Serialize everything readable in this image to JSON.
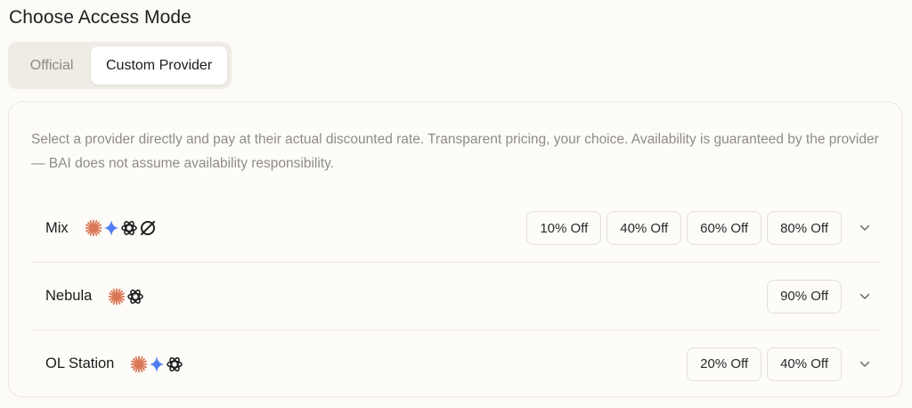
{
  "page": {
    "title": "Choose Access Mode"
  },
  "tabs": [
    {
      "label": "Official",
      "active": false
    },
    {
      "label": "Custom Provider",
      "active": true
    }
  ],
  "panel": {
    "description": "Select a provider directly and pay at their actual discounted rate. Transparent pricing, your choice. Availability is guaranteed by the provider — BAI does not assume availability responsibility."
  },
  "providers": [
    {
      "name": "Mix",
      "icons": [
        "claude-icon",
        "gemini-icon",
        "openai-icon",
        "grok-icon"
      ],
      "discounts": [
        "10% Off",
        "40% Off",
        "60% Off",
        "80% Off"
      ]
    },
    {
      "name": "Nebula",
      "icons": [
        "claude-icon",
        "openai-icon"
      ],
      "discounts": [
        "90% Off"
      ]
    },
    {
      "name": "OL Station",
      "icons": [
        "claude-icon",
        "gemini-icon",
        "openai-icon"
      ],
      "discounts": [
        "20% Off",
        "40% Off"
      ]
    }
  ],
  "colors": {
    "background": "#fcfbf7",
    "claude": "#d97757",
    "gemini": "#4f7ef2",
    "muted_text": "#8f8c86"
  }
}
